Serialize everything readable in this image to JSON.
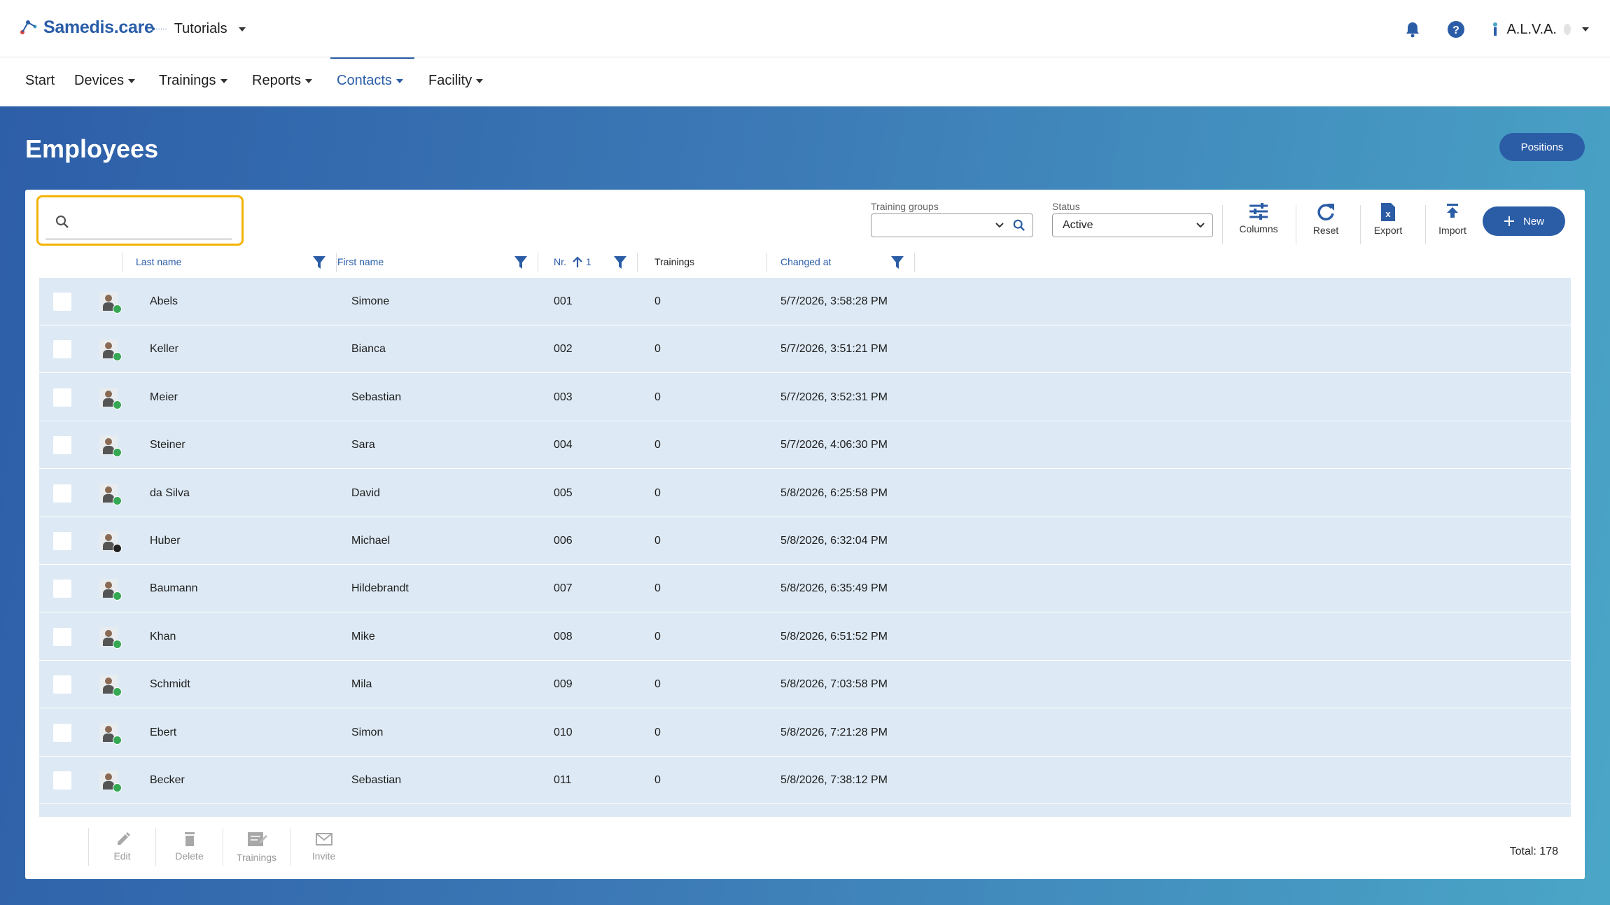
{
  "header": {
    "brand": "Samedis.care",
    "tenant_logo_text": "●·····",
    "tenant": "Tutorials",
    "user": "A.L.V.A."
  },
  "nav": {
    "items": [
      "Start",
      "Devices",
      "Trainings",
      "Reports",
      "Contacts",
      "Facility"
    ],
    "active": "Contacts"
  },
  "page": {
    "title": "Employees",
    "positions_label": "Positions"
  },
  "toolbar": {
    "search_value": "",
    "training_groups_label": "Training groups",
    "training_groups_value": "",
    "status_label": "Status",
    "status_value": "Active",
    "columns_label": "Columns",
    "reset_label": "Reset",
    "export_label": "Export",
    "import_label": "Import",
    "new_label": "New"
  },
  "table": {
    "columns": {
      "last_name": "Last name",
      "first_name": "First name",
      "nr": "Nr.",
      "nr_sort_index": "1",
      "trainings": "Trainings",
      "changed_at": "Changed at"
    },
    "rows": [
      {
        "last": "Abels",
        "first": "Simone",
        "nr": "001",
        "trainings": "0",
        "changed": "5/7/2026, 3:58:28 PM",
        "online": true
      },
      {
        "last": "Keller",
        "first": "Bianca",
        "nr": "002",
        "trainings": "0",
        "changed": "5/7/2026, 3:51:21 PM",
        "online": true
      },
      {
        "last": "Meier",
        "first": "Sebastian",
        "nr": "003",
        "trainings": "0",
        "changed": "5/7/2026, 3:52:31 PM",
        "online": true
      },
      {
        "last": "Steiner",
        "first": "Sara",
        "nr": "004",
        "trainings": "0",
        "changed": "5/7/2026, 4:06:30 PM",
        "online": true
      },
      {
        "last": "da Silva",
        "first": "David",
        "nr": "005",
        "trainings": "0",
        "changed": "5/8/2026, 6:25:58 PM",
        "online": true
      },
      {
        "last": "Huber",
        "first": "Michael",
        "nr": "006",
        "trainings": "0",
        "changed": "5/8/2026, 6:32:04 PM",
        "online": false
      },
      {
        "last": "Baumann",
        "first": "Hildebrandt",
        "nr": "007",
        "trainings": "0",
        "changed": "5/8/2026, 6:35:49 PM",
        "online": true
      },
      {
        "last": "Khan",
        "first": "Mike",
        "nr": "008",
        "trainings": "0",
        "changed": "5/8/2026, 6:51:52 PM",
        "online": true
      },
      {
        "last": "Schmidt",
        "first": "Mila",
        "nr": "009",
        "trainings": "0",
        "changed": "5/8/2026, 7:03:58 PM",
        "online": true
      },
      {
        "last": "Ebert",
        "first": "Simon",
        "nr": "010",
        "trainings": "0",
        "changed": "5/8/2026, 7:21:28 PM",
        "online": true
      },
      {
        "last": "Becker",
        "first": "Sebastian",
        "nr": "011",
        "trainings": "0",
        "changed": "5/8/2026, 7:38:12 PM",
        "online": true
      }
    ]
  },
  "footer": {
    "edit_label": "Edit",
    "delete_label": "Delete",
    "trainings_label": "Trainings",
    "invite_label": "Invite",
    "total": "Total: 178"
  },
  "colors": {
    "primary": "#2b5ca6",
    "highlight": "#f4b400",
    "row_bg": "#dde9f4",
    "online": "#35a853"
  }
}
